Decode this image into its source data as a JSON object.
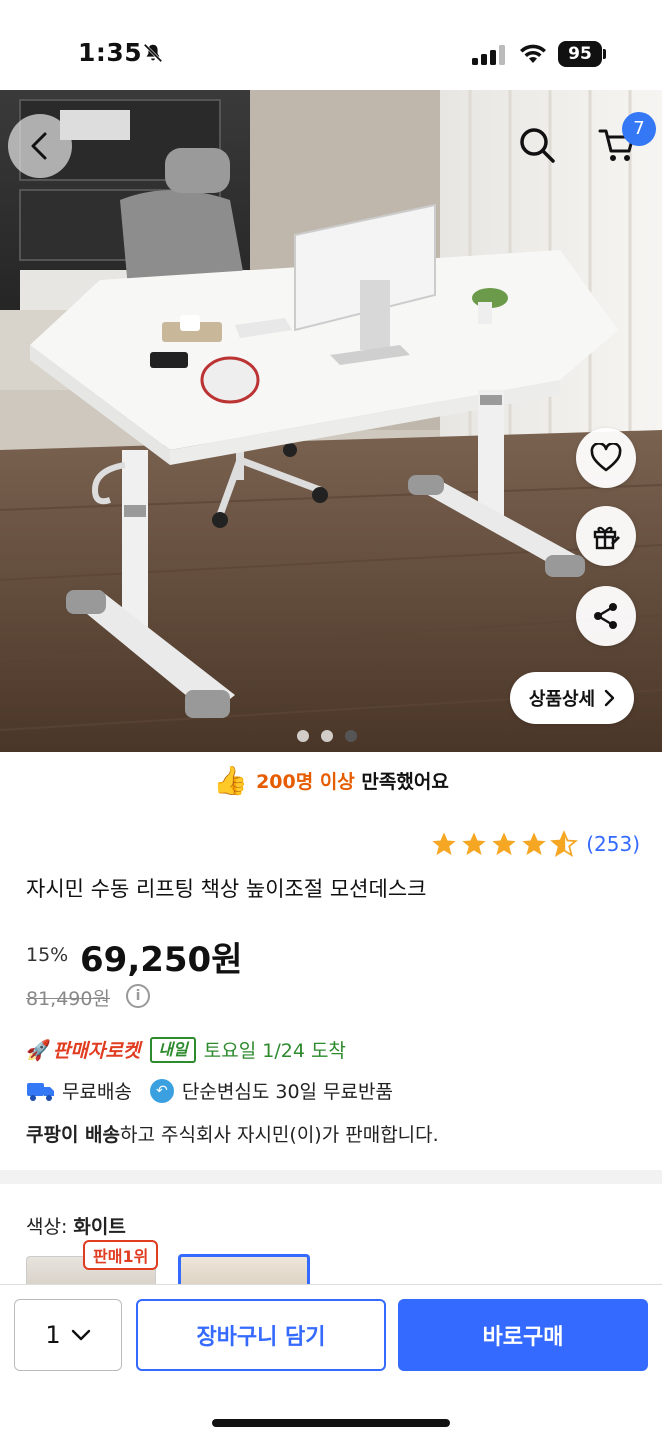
{
  "status_bar": {
    "time": "1:35",
    "battery": "95"
  },
  "header": {
    "cart_count": "7"
  },
  "hero": {
    "detail_label": "상품상세",
    "image_dots": 3,
    "active_dot": 2
  },
  "satisfaction": {
    "highlight": "200명 이상",
    "text": " 만족했어요"
  },
  "rating": {
    "stars": 4.5,
    "count": "(253)"
  },
  "product": {
    "title": "자시민 수동 리프팅 책상 높이조절 모션데스크",
    "discount": "15%",
    "price": "69,250원",
    "original_price": "81,490원"
  },
  "delivery": {
    "rocket_label": "판매자로켓",
    "tomorrow_badge": "내일",
    "arrival": "토요일 1/24 도착",
    "free_shipping": "무료배송",
    "free_return": "단순변심도 30일 무료반품",
    "seller_bold": "쿠팡이 배송",
    "seller_rest": "하고 주식회사 자시민(이)가 판매합니다."
  },
  "options": {
    "color_prefix": "색상: ",
    "color_value": "화이트",
    "best_badge": "판매1위"
  },
  "bottom_bar": {
    "quantity": "1",
    "add_to_cart": "장바구니 담기",
    "buy_now": "바로구매"
  },
  "colors": {
    "accent": "#346aff",
    "rocket": "#e03c20",
    "arrival_green": "#2d8a2d",
    "star": "#f5a623",
    "satisfied_orange": "#e65c00"
  }
}
